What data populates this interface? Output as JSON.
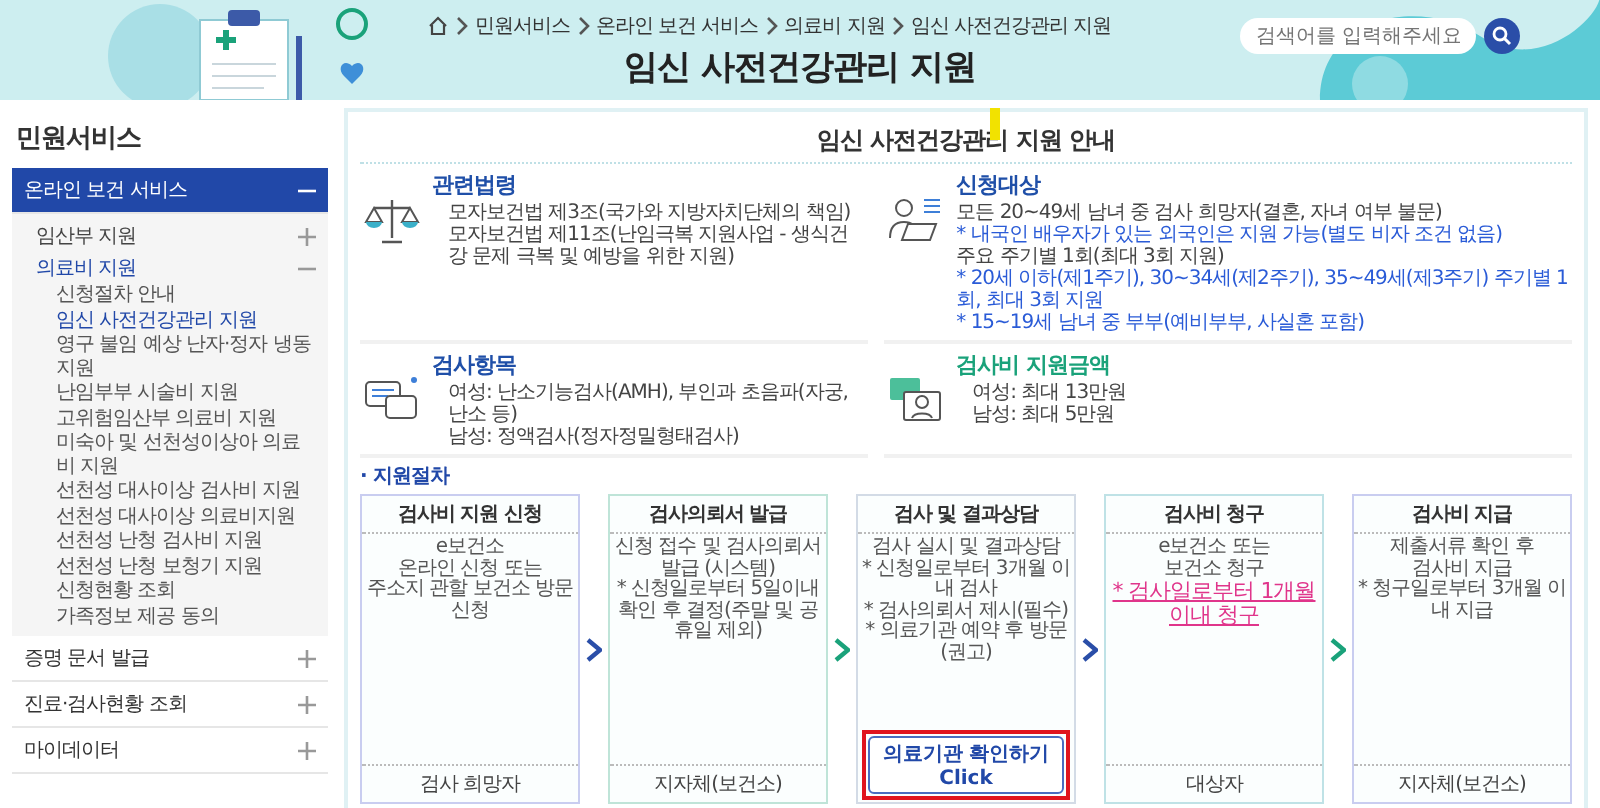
{
  "header": {
    "breadcrumb": [
      "민원서비스",
      "온라인 보건 서비스",
      "의료비 지원",
      "임신 사전건강관리 지원"
    ],
    "title": "임신 사전건강관리 지원",
    "search": {
      "placeholder": "검색어를 입력해주세요"
    }
  },
  "sidebar": {
    "title": "민원서비스",
    "items": [
      {
        "label": "온라인 보건 서비스",
        "expanded": true,
        "selected": true,
        "children": [
          {
            "label": "임산부 지원",
            "expanded": false,
            "selected": false
          },
          {
            "label": "의료비 지원",
            "expanded": true,
            "selected": true,
            "children": [
              {
                "label": "신청절차 안내",
                "selected": false
              },
              {
                "label": "임신 사전건강관리 지원",
                "selected": true
              },
              {
                "label": "영구 불임 예상 난자·정자 냉동 지원",
                "selected": false
              },
              {
                "label": "난임부부 시술비 지원",
                "selected": false
              },
              {
                "label": "고위험임산부 의료비 지원",
                "selected": false
              },
              {
                "label": "미숙아 및 선천성이상아 의료비 지원",
                "selected": false
              },
              {
                "label": "선천성 대사이상 검사비 지원",
                "selected": false
              },
              {
                "label": "선천성 대사이상 의료비지원",
                "selected": false
              },
              {
                "label": "선천성 난청 검사비 지원",
                "selected": false
              },
              {
                "label": "선천성 난청 보청기 지원",
                "selected": false
              },
              {
                "label": "신청현황 조회",
                "selected": false
              },
              {
                "label": "가족정보 제공 동의",
                "selected": false
              }
            ]
          }
        ]
      },
      {
        "label": "증명 문서 발급",
        "expanded": false,
        "selected": false
      },
      {
        "label": "진료·검사현황 조회",
        "expanded": false,
        "selected": false
      },
      {
        "label": "마이데이터",
        "expanded": false,
        "selected": false
      }
    ]
  },
  "guide": {
    "title": "임신 사전건강관리 지원 안내",
    "title_marker": true,
    "sections": [
      {
        "kind": "law",
        "heading": "관련법령",
        "color": "#1f4fa8",
        "lines": [
          {
            "kind": "bullet",
            "text": "모자보건법 제3조(국가와 지방자치단체의 책임)"
          },
          {
            "kind": "bullet",
            "text": "모자보건법 제11조(난임극복 지원사업 - 생식건강 문제 극복 및 예방을 위한 지원)"
          }
        ]
      },
      {
        "kind": "target",
        "heading": "신청대상",
        "color": "#1f4fa8",
        "lines": [
          {
            "kind": "plain",
            "text": "모든 20~49세 남녀 중 검사 희망자(결혼, 자녀 여부 불문)"
          },
          {
            "kind": "note",
            "text": "* 내국인 배우자가 있는 외국인은 지원 가능(별도 비자 조건 없음)"
          },
          {
            "kind": "plain",
            "text": "주요 주기별 1회(최대 3회 지원)"
          },
          {
            "kind": "note",
            "text": "* 20세 이하(제1주기), 30~34세(제2주기), 35~49세(제3주기) 주기별 1회, 최대 3회 지원"
          },
          {
            "kind": "note",
            "text": "* 15~19세 남녀 중 부부(예비부부, 사실혼 포함)"
          }
        ]
      },
      {
        "kind": "exam",
        "heading": "검사항목",
        "color": "#1f4fa8",
        "lines": [
          {
            "kind": "bullet",
            "text": "여성: 난소기능검사(AMH), 부인과 초음파(자궁, 난소 등)"
          },
          {
            "kind": "bullet",
            "text": "남성: 정액검사(정자정밀형태검사)"
          }
        ]
      },
      {
        "kind": "cost",
        "heading": "검사비 지원금액",
        "color": "#1aa27a",
        "lines": [
          {
            "kind": "bullet",
            "text": "여성: 최대 13만원"
          },
          {
            "kind": "bullet",
            "text": "남성: 최대 5만원"
          }
        ]
      }
    ],
    "procedure": {
      "title": "· 지원절차",
      "steps": [
        {
          "title": "검사비 지원 신청",
          "color": "#c9cdf0",
          "lines": [
            {
              "kind": "plain",
              "text": "e보건소"
            },
            {
              "kind": "plain",
              "text": "온라인 신청 또는"
            },
            {
              "kind": "plain",
              "text": "주소지 관할 보건소 방문 신청"
            }
          ],
          "footer": "검사 희망자"
        },
        {
          "title": "검사의뢰서 발급",
          "color": "#bfe4d8",
          "lines": [
            {
              "kind": "plain",
              "text": "신청 접수 및 검사의뢰서 발급 (시스템)"
            },
            {
              "kind": "note",
              "text": "* 신청일로부터 5일이내 확인 후 결정(주말 및 공휴일 제외)"
            }
          ],
          "footer": "지자체(보건소)"
        },
        {
          "title": "검사 및 결과상담",
          "color": "#d3dbe6",
          "lines": [
            {
              "kind": "plain",
              "text": "검사 실시 및 결과상담"
            },
            {
              "kind": "note",
              "text": "* 신청일로부터 3개월 이내 검사"
            },
            {
              "kind": "note",
              "text": "* 검사의뢰서 제시(필수)"
            },
            {
              "kind": "note",
              "text": "* 의료기관 예약 후 방문(권고)"
            }
          ],
          "button": {
            "lines": [
              "의료기관 확인하기",
              "Click"
            ],
            "highlighted": true
          }
        },
        {
          "title": "검사비 청구",
          "color": "#bfe2e6",
          "lines": [
            {
              "kind": "plain",
              "text": "e보건소 또는"
            },
            {
              "kind": "plain",
              "text": "보건소 청구"
            },
            {
              "kind": "emphasis",
              "text": "* 검사일로부터 1개월 이내 청구"
            }
          ],
          "footer": "대상자"
        },
        {
          "title": "검사비 지급",
          "color": "#c9cdf0",
          "lines": [
            {
              "kind": "plain",
              "text": "제출서류 확인 후"
            },
            {
              "kind": "plain",
              "text": "검사비 지급"
            },
            {
              "kind": "note",
              "text": "* 청구일로부터 3개월 이내 지급"
            }
          ],
          "footer": "지자체(보건소)"
        }
      ]
    }
  }
}
